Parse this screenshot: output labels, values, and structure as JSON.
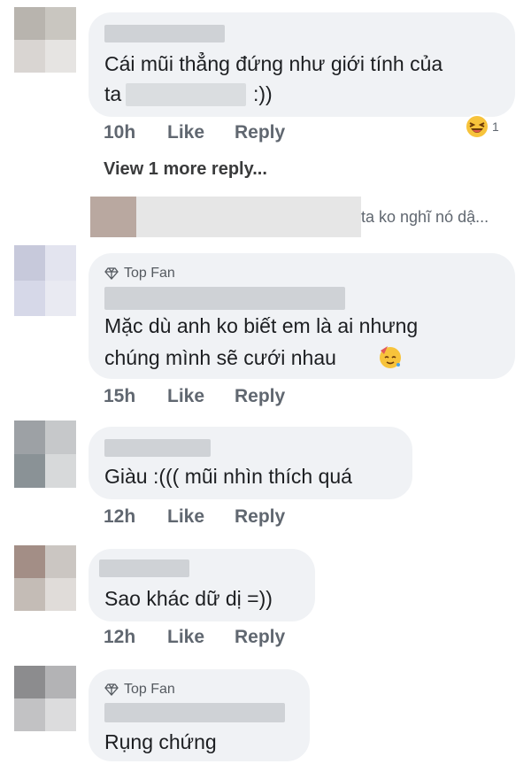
{
  "comments": [
    {
      "text_lines": [
        "Cái mũi thẳng đứng như giới tính của",
        "ta",
        ":))"
      ],
      "time": "10h",
      "like": "Like",
      "reply": "Reply",
      "reaction_icon": "laughing-emoji-icon",
      "reaction_count": "1"
    },
    {
      "badge": "Top Fan",
      "text_lines": [
        "Mặc dù anh ko biết em là ai nhưng",
        "chúng mình sẽ cưới nhau"
      ],
      "time": "15h",
      "like": "Like",
      "reply": "Reply"
    },
    {
      "text_lines": [
        "Giàu :((( mũi nhìn thích quá"
      ],
      "time": "12h",
      "like": "Like",
      "reply": "Reply"
    },
    {
      "text_lines": [
        "Sao khác dữ dị =))"
      ],
      "time": "12h",
      "like": "Like",
      "reply": "Reply"
    },
    {
      "badge": "Top Fan",
      "text_lines": [
        "Rụng chứng"
      ]
    }
  ],
  "view_more": "View 1 more reply...",
  "reply_preview_text": "ta ko nghĩ nó dậ...",
  "colors": {
    "bubble": "#f0f2f5",
    "meta": "#606770",
    "text": "#1c1e21"
  }
}
